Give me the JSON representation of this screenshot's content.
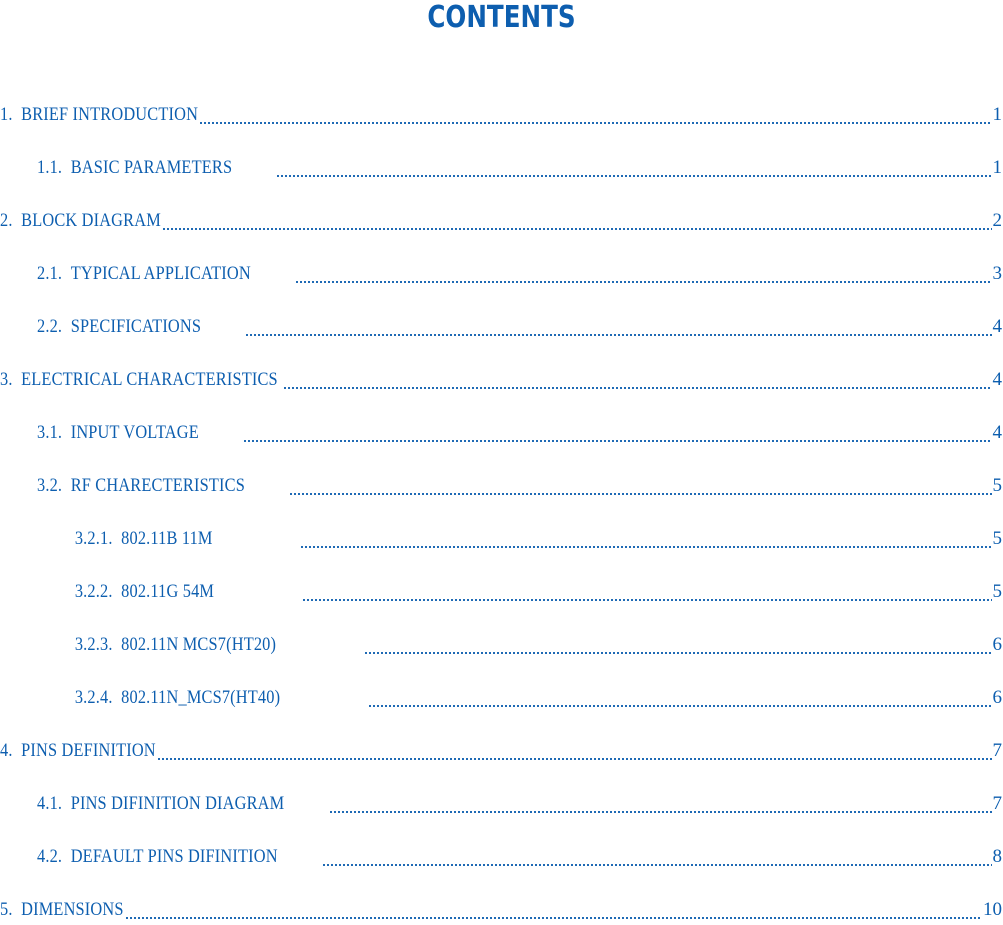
{
  "document": {
    "title": "CONTENTS",
    "accent_color": "#0d5eaf"
  },
  "toc": [
    {
      "number": "1.",
      "text": "BRIEF INTRODUCTION",
      "page": "1",
      "level": 1
    },
    {
      "number": "1.1.",
      "text": "BASIC PARAMETERS",
      "page": "1",
      "level": 2
    },
    {
      "number": "2.",
      "text": "BLOCK DIAGRAM",
      "page": "2",
      "level": 1
    },
    {
      "number": "2.1.",
      "text": "TYPICAL APPLICATION",
      "page": "3",
      "level": 2
    },
    {
      "number": "2.2.",
      "text": "SPECIFICATIONS",
      "page": "4",
      "level": 2
    },
    {
      "number": "3.",
      "text": "ELECTRICAL CHARACTERISTICS ",
      "page": "4",
      "level": 1
    },
    {
      "number": "3.1.",
      "text": "INPUT VOLTAGE",
      "page": "4",
      "level": 2
    },
    {
      "number": "3.2.",
      "text": "RF CHARECTERISTICS",
      "page": "5",
      "level": 2
    },
    {
      "number": "3.2.1.",
      "text": "802.11B 11M",
      "page": "5",
      "level": 3
    },
    {
      "number": "3.2.2.",
      "text": "802.11G 54M",
      "page": "5",
      "level": 3
    },
    {
      "number": "3.2.3.",
      "text": "802.11N MCS7(HT20)",
      "page": "6",
      "level": 3
    },
    {
      "number": "3.2.4.",
      "text": "802.11N_MCS7(HT40)",
      "page": "6",
      "level": 3
    },
    {
      "number": "4.",
      "text": "PINS DEFINITION",
      "page": "7",
      "level": 1
    },
    {
      "number": "4.1.",
      "text": "PINS DIFINITION DIAGRAM",
      "page": "7",
      "level": 2
    },
    {
      "number": "4.2.",
      "text": "DEFAULT PINS DIFINITION",
      "page": "8",
      "level": 2
    },
    {
      "number": "5.",
      "text": "DIMENSIONS",
      "page": "10",
      "level": 1
    }
  ]
}
